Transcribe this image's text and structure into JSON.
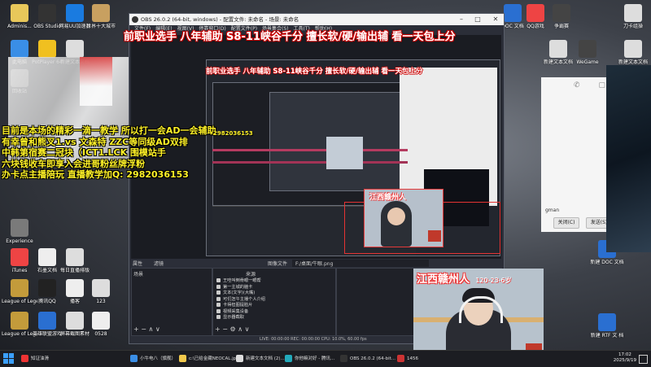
{
  "desktop_icons_left": [
    {
      "label": "Adminis...",
      "color": "#e8c75a"
    },
    {
      "label": "OBS Studio",
      "color": "#333"
    },
    {
      "label": "网易UU加速器",
      "color": "#1a7be0"
    },
    {
      "label": "世界十大城市",
      "color": "#c8a060"
    },
    {
      "label": "此电脑",
      "color": "#3a8ee6"
    },
    {
      "label": "PotPlayer 64",
      "color": "#f0c020"
    },
    {
      "label": "新建文本文档",
      "color": "#ddd"
    },
    {
      "label": "回收站",
      "color": "#999"
    },
    {
      "label": "Experience",
      "color": "#7a7a7a"
    },
    {
      "label": "iTunes",
      "color": "#e44"
    },
    {
      "label": "石墨文档",
      "color": "#eee"
    },
    {
      "label": "每日直播排版",
      "color": "#ddd"
    },
    {
      "label": "League of Legends",
      "color": "#c39b3b"
    },
    {
      "label": "腾讯QQ",
      "color": "#222"
    },
    {
      "label": "播客",
      "color": "#eee"
    },
    {
      "label": "123",
      "color": "#ddd"
    },
    {
      "label": "League of Legends",
      "color": "#c39b3b"
    },
    {
      "label": "英雄联盟游戏",
      "color": "#2a6fd1"
    },
    {
      "label": "屏幕截图素材",
      "color": "#ddd"
    },
    {
      "label": "0528",
      "color": "#eee"
    }
  ],
  "desktop_icons_right": [
    {
      "label": "DOC 文档",
      "color": "#2a6fd1"
    },
    {
      "label": "QQ游戏",
      "color": "#e44"
    },
    {
      "label": "争霸赛",
      "color": "#444"
    },
    {
      "label": "刀卡组操",
      "color": "#ddd"
    },
    {
      "label": "新建文本文档",
      "color": "#ddd"
    },
    {
      "label": "WeGame",
      "color": "#444"
    },
    {
      "label": "新建文本文档",
      "color": "#ddd"
    },
    {
      "label": "新建 DOC 文档",
      "color": "#2a6fd1"
    },
    {
      "label": "新建 RTF 文 档",
      "color": "#2a6fd1"
    }
  ],
  "obs": {
    "title": "OBS 26.0.2 (64-bit, windows) - 配置文件: 未命名 - 场景: 未命名",
    "menu": [
      "文件(F)",
      "编辑(E)",
      "视图(V)",
      "停靠窗口(D)",
      "配置文件(P)",
      "场景集合(S)",
      "工具(T)",
      "帮助(H)"
    ],
    "inner_title": "前职业选手 八年辅助 S8-11峡谷千分 擅长软/硬/输出辅 看一天包上分",
    "toolbar": {
      "properties": "属性",
      "filters": "滤镜",
      "image_file": "图像文件",
      "path": "F:/桌面/牛眼.png"
    },
    "scenes_title": "场景",
    "sources_title": "来源",
    "sources": [
      "王哇叫倒骨眼一眼帮",
      "第一主城的脑卡",
      "文本(文字)(大嘴)",
      "可们怎午主播个人介绍",
      "卡得但图提脸片",
      "视频采集设备",
      "显示器截取"
    ],
    "status": "LIVE: 00:00:00    REC: 00:00:00    CPU: 10.0%, 60.00 fps"
  },
  "overlay": {
    "banner": "前职业选手 八年辅助 S8-11峡谷千分 擅长软/硬/输出辅 看一天包上分",
    "lines": [
      "目前是本场的精彩一滴一教学 所以打一会AD一会辅助",
      "有幸曾和熊叉1.vs 文森特 ZZC等同级AD双排",
      "中韩第宿赛二冠块（ICT1.LCK 围模站手",
      "六块钱收车即享入会进哥粉丝牌浮粉",
      "办卡点主播陪玩 直播教学加Q: 2982036153"
    ],
    "qq_small": "2982036153"
  },
  "webcam": {
    "caption": "江西赣州人",
    "sub": "120-23-6岁"
  },
  "webcam_small": {
    "caption": "江西赣州人"
  },
  "chat": {
    "sender": "gman",
    "close_label": "关闭(C)",
    "send_label": "发送(S)"
  },
  "taskbar": {
    "items": [
      {
        "label": "知证油滑",
        "color": "#e33"
      },
      {
        "label": "小牛电八（旗舰）",
        "color": "#3a8ee6"
      },
      {
        "label": "c:\\已给金藏NEOCAL.jpe...",
        "color": "#f2c94c"
      },
      {
        "label": "新建文本文档 (2)...",
        "color": "#ddd"
      },
      {
        "label": "你他嘛对好 - 腾讯...",
        "color": "#2ab"
      },
      {
        "label": "OBS 26.0.2 (64-bit...",
        "color": "#333"
      },
      {
        "label": "1456",
        "color": "#c33"
      }
    ],
    "time": "17:02",
    "date": "2025/9/19"
  }
}
